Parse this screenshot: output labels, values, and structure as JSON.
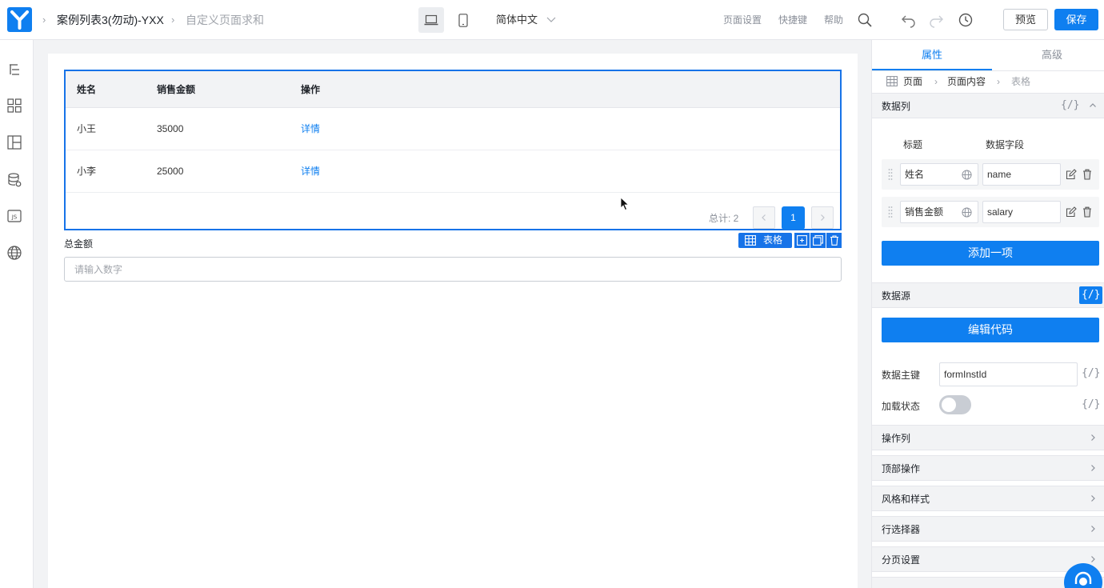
{
  "header": {
    "app_name": "案例列表3(勿动)-YXX",
    "page_name": "自定义页面求和",
    "language": "简体中文",
    "page_settings": "页面设置",
    "shortcuts": "快捷键",
    "help": "帮助",
    "preview_label": "预览",
    "save_label": "保存"
  },
  "table": {
    "columns": [
      "姓名",
      "销售金额",
      "操作"
    ],
    "rows": [
      {
        "name": "小王",
        "amount": "35000",
        "action": "详情"
      },
      {
        "name": "小李",
        "amount": "25000",
        "action": "详情"
      }
    ],
    "total_text": "总计: 2",
    "current_page": "1",
    "selection_tag": "表格"
  },
  "form": {
    "total_label": "总金额",
    "total_placeholder": "请输入数字"
  },
  "panel": {
    "tabs": [
      "属性",
      "高级"
    ],
    "breadcrumb": [
      "页面",
      "页面内容",
      "表格"
    ],
    "data_columns": {
      "title": "数据列",
      "code_icon": "{/}",
      "col_title_header": "标题",
      "col_field_header": "数据字段",
      "items": [
        {
          "title": "姓名",
          "field": "name"
        },
        {
          "title": "销售金额",
          "field": "salary"
        }
      ],
      "add_label": "添加一项"
    },
    "data_source": {
      "title": "数据源",
      "code_icon": "{/}",
      "edit_code_label": "编辑代码",
      "primary_key_label": "数据主键",
      "primary_key_value": "formInstId",
      "loading_label": "加载状态",
      "loading_on": false
    },
    "sections": [
      "操作列",
      "顶部操作",
      "风格和样式",
      "行选择器",
      "分页设置"
    ]
  },
  "colors": {
    "accent": "#0f7ff0",
    "selection": "#1773e8"
  }
}
